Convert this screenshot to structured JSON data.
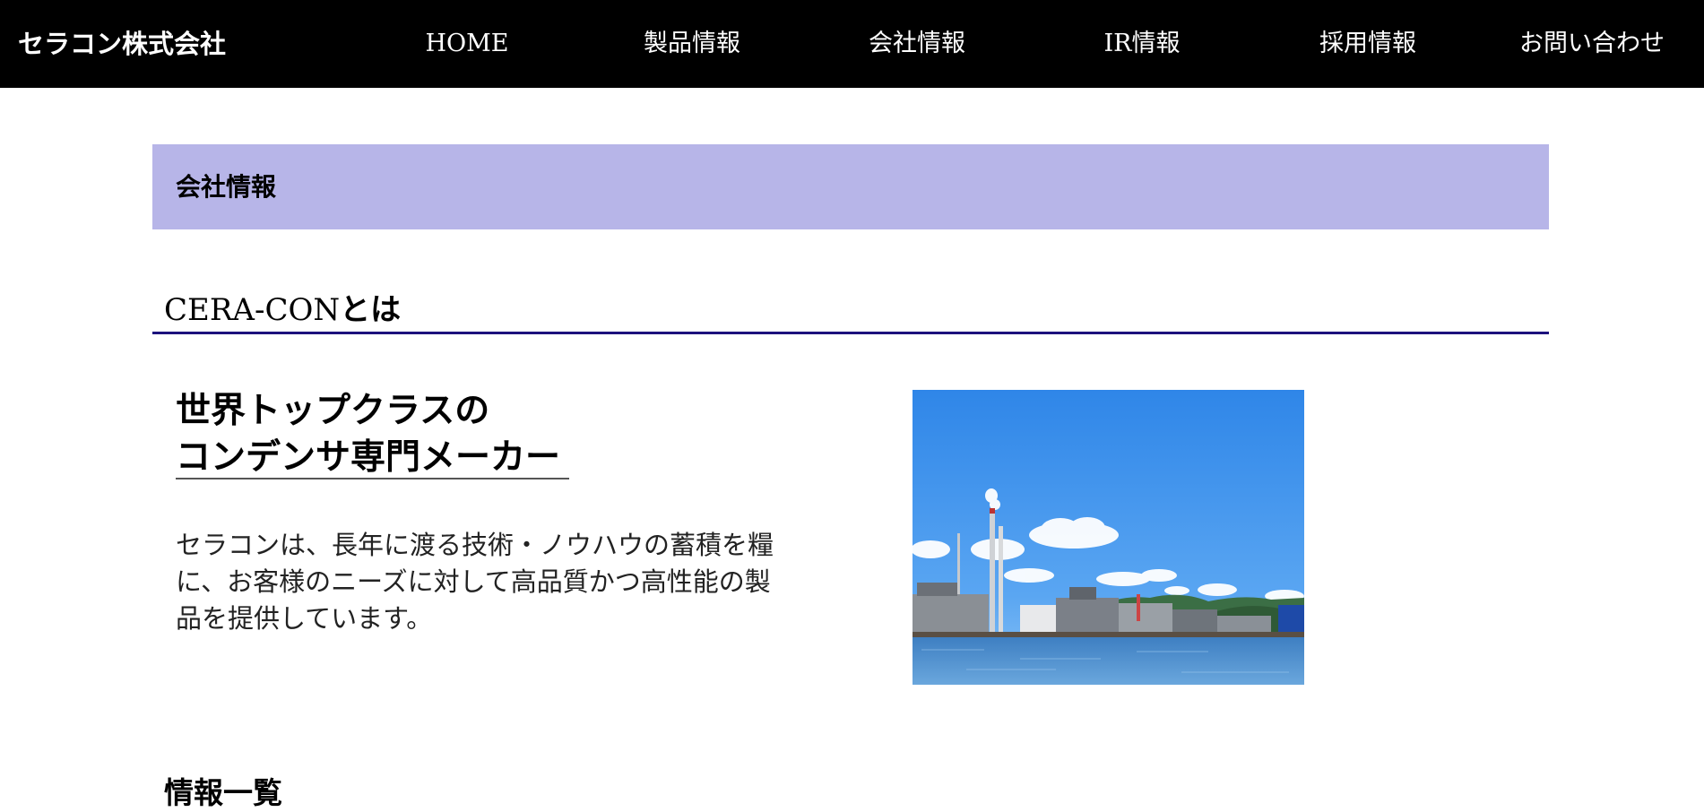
{
  "header": {
    "logo": "セラコン株式会社",
    "nav": [
      {
        "label": "HOME"
      },
      {
        "label": "製品情報"
      },
      {
        "label": "会社情報"
      },
      {
        "label": "IR情報"
      },
      {
        "label": "採用情報"
      },
      {
        "label": "お問い合わせ"
      }
    ],
    "background_color": "#000000"
  },
  "main": {
    "section_title": "会社情報",
    "section_color": "#b7b5e8",
    "about": {
      "heading_latin": "CERA-CON",
      "heading_suffix": "とは",
      "rule_color": "#1c127d",
      "tagline_line1": "世界トップクラスの",
      "tagline_line2": "コンデンサ専門メーカー",
      "description": "セラコンは、長年に渡る技術・ノウハウの蓄積を糧に、お客様のニーズに対して高品質かつ高性能の製品を提供しています。",
      "photo_icon": "industrial-harbor-photo"
    },
    "info_heading": "情報一覧"
  }
}
